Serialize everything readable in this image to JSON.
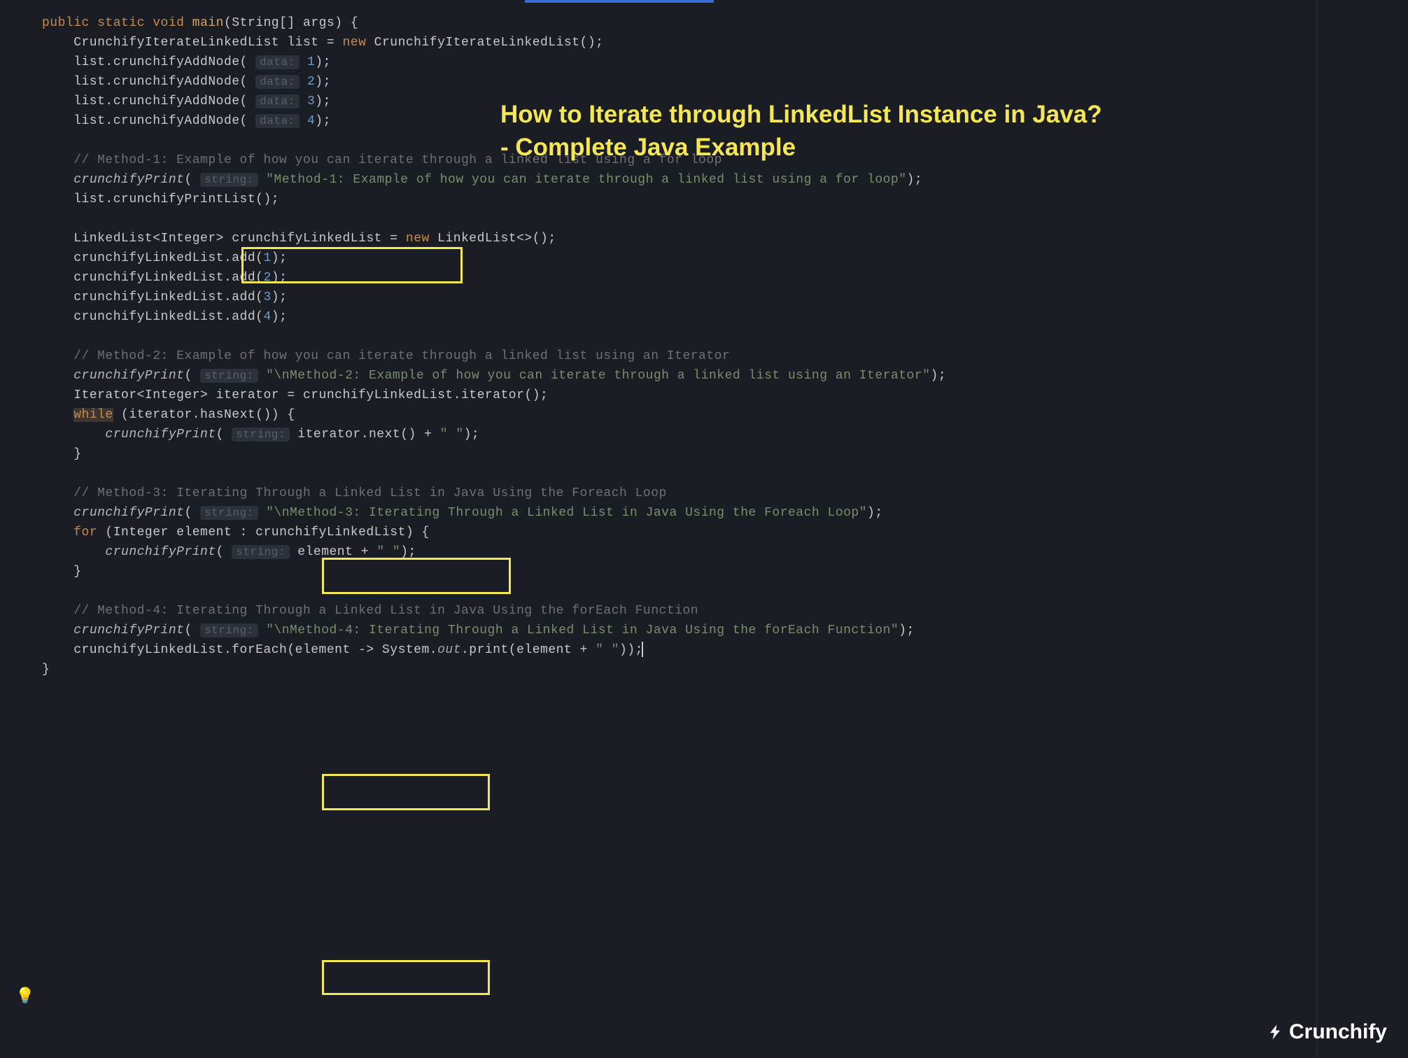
{
  "overlay": {
    "title_line1": "How to Iterate through LinkedList Instance in Java?",
    "title_line2": "- Complete Java Example"
  },
  "logo": {
    "text": "Crunchify"
  },
  "hints": {
    "data": "data:",
    "string": "string:"
  },
  "code": {
    "sig": {
      "public": "public",
      "static": "static",
      "void": "void",
      "main": "main",
      "params": "(String[] args) {"
    },
    "l1": {
      "a": "    CrunchifyIterateLinkedList list = ",
      "new": "new",
      "b": " CrunchifyIterateLinkedList();"
    },
    "add1": {
      "a": "    list.crunchifyAddNode( ",
      "n": "1",
      "b": ");"
    },
    "add2": {
      "a": "    list.crunchifyAddNode( ",
      "n": "2",
      "b": ");"
    },
    "add3": {
      "a": "    list.crunchifyAddNode( ",
      "n": "3",
      "b": ");"
    },
    "add4": {
      "a": "    list.crunchifyAddNode( ",
      "n": "4",
      "b": ");"
    },
    "c1": "    // Method-1: Example of how you can iterate through a linked list using a for loop",
    "p1": {
      "a": "    ",
      "fn": "crunchifyPrint",
      "b": "( ",
      "s": "\"Method-1: Example of how you can iterate through a linked list using a for loop\"",
      "c": ");"
    },
    "pl": "    list.crunchifyPrintList();",
    "ll": {
      "a": "    LinkedList<Integer> crunchifyLinkedList = ",
      "new": "new",
      "b": " LinkedList<>();"
    },
    "la1": {
      "a": "    crunchifyLinkedList.add(",
      "n": "1",
      "b": ");"
    },
    "la2": {
      "a": "    crunchifyLinkedList.add(",
      "n": "2",
      "b": ");"
    },
    "la3": {
      "a": "    crunchifyLinkedList.add(",
      "n": "3",
      "b": ");"
    },
    "la4": {
      "a": "    crunchifyLinkedList.add(",
      "n": "4",
      "b": ");"
    },
    "c2": "    // Method-2: Example of how you can iterate through a linked list using an Iterator",
    "p2": {
      "a": "    ",
      "fn": "crunchifyPrint",
      "b": "( ",
      "s": "\"\\nMethod-2: Example of how you can iterate through a linked list using an Iterator\"",
      "c": ");"
    },
    "it": "    Iterator<Integer> iterator = crunchifyLinkedList.iterator();",
    "wh": {
      "a": "    ",
      "kw": "while",
      "b": " (iterator.hasNext()) {"
    },
    "wb": {
      "a": "        ",
      "fn": "crunchifyPrint",
      "b": "( ",
      "c": " iterator.next() + ",
      "s": "\" \"",
      "d": ");"
    },
    "cb1": "    }",
    "c3": "    // Method-3: Iterating Through a Linked List in Java Using the Foreach Loop",
    "p3": {
      "a": "    ",
      "fn": "crunchifyPrint",
      "b": "( ",
      "s": "\"\\nMethod-3: Iterating Through a Linked List in Java Using the Foreach Loop\"",
      "c": ");"
    },
    "for": {
      "a": "    ",
      "kw": "for",
      "b": " (Integer element : crunchifyLinkedList) {"
    },
    "fb": {
      "a": "        ",
      "fn": "crunchifyPrint",
      "b": "( ",
      "c": " element + ",
      "s": "\" \"",
      "d": ");"
    },
    "cb2": "    }",
    "c4": "    // Method-4: Iterating Through a Linked List in Java Using the forEach Function",
    "p4": {
      "a": "    ",
      "fn": "crunchifyPrint",
      "b": "( ",
      "s": "\"\\nMethod-4: Iterating Through a Linked List in Java Using the forEach Function\"",
      "c": ");"
    },
    "fe": {
      "a": "    crunchifyLinkedList.forEach(element -> System.",
      "out": "out",
      "b": ".print(element + ",
      "s": "\" \"",
      "c": "));"
    },
    "end": "}"
  }
}
